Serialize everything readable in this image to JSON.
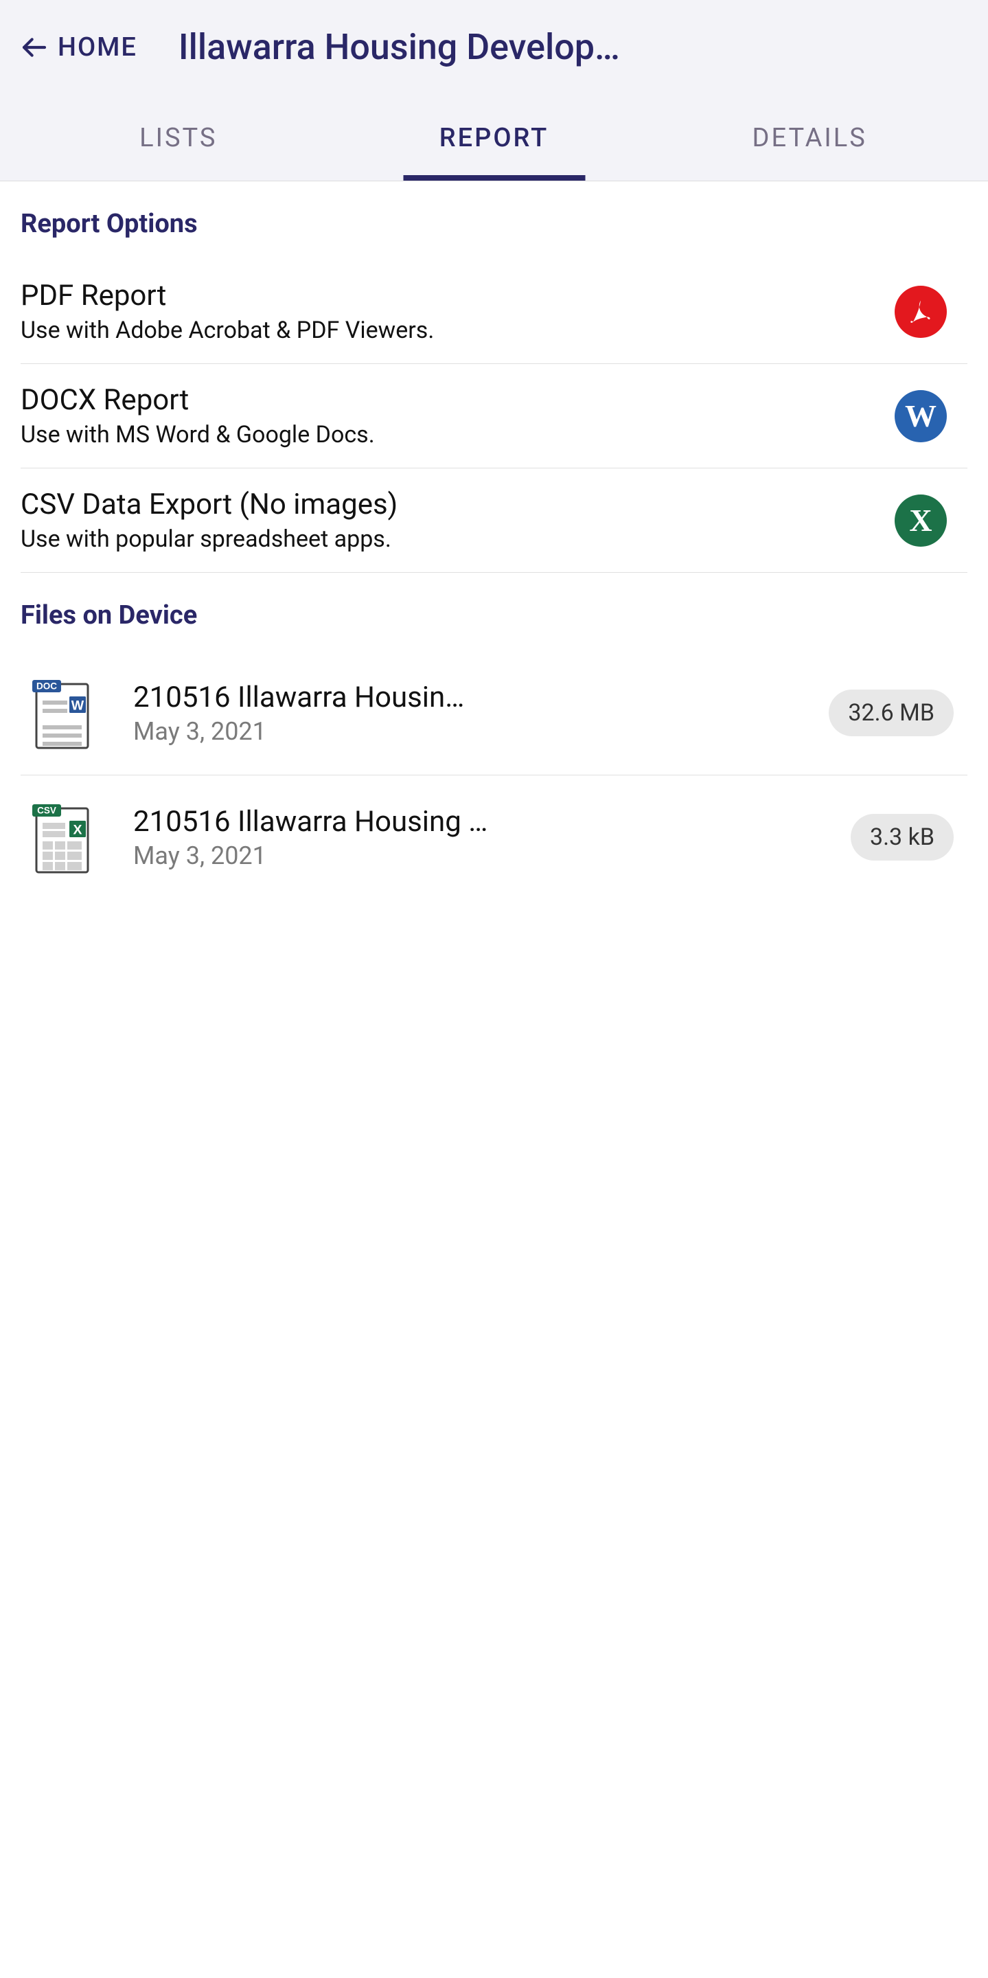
{
  "header": {
    "home_label": "HOME",
    "title": "Illawarra Housing Develop…"
  },
  "tabs": {
    "lists": "LISTS",
    "report": "REPORT",
    "details": "DETAILS",
    "active": "report"
  },
  "report_options": {
    "section_title": "Report Options",
    "items": [
      {
        "title": "PDF Report",
        "desc": "Use with Adobe Acrobat & PDF Viewers.",
        "icon": "pdf"
      },
      {
        "title": "DOCX Report",
        "desc": "Use with MS Word & Google Docs.",
        "icon": "word"
      },
      {
        "title": "CSV Data Export (No images)",
        "desc": "Use with popular spreadsheet apps.",
        "icon": "excel"
      }
    ]
  },
  "files": {
    "section_title": "Files on Device",
    "items": [
      {
        "name": "210516 Illawarra Housin…",
        "date": "May 3, 2021",
        "size": "32.6 MB",
        "type": "doc"
      },
      {
        "name": "210516 Illawarra Housing …",
        "date": "May 3, 2021",
        "size": "3.3 kB",
        "type": "csv"
      }
    ]
  }
}
